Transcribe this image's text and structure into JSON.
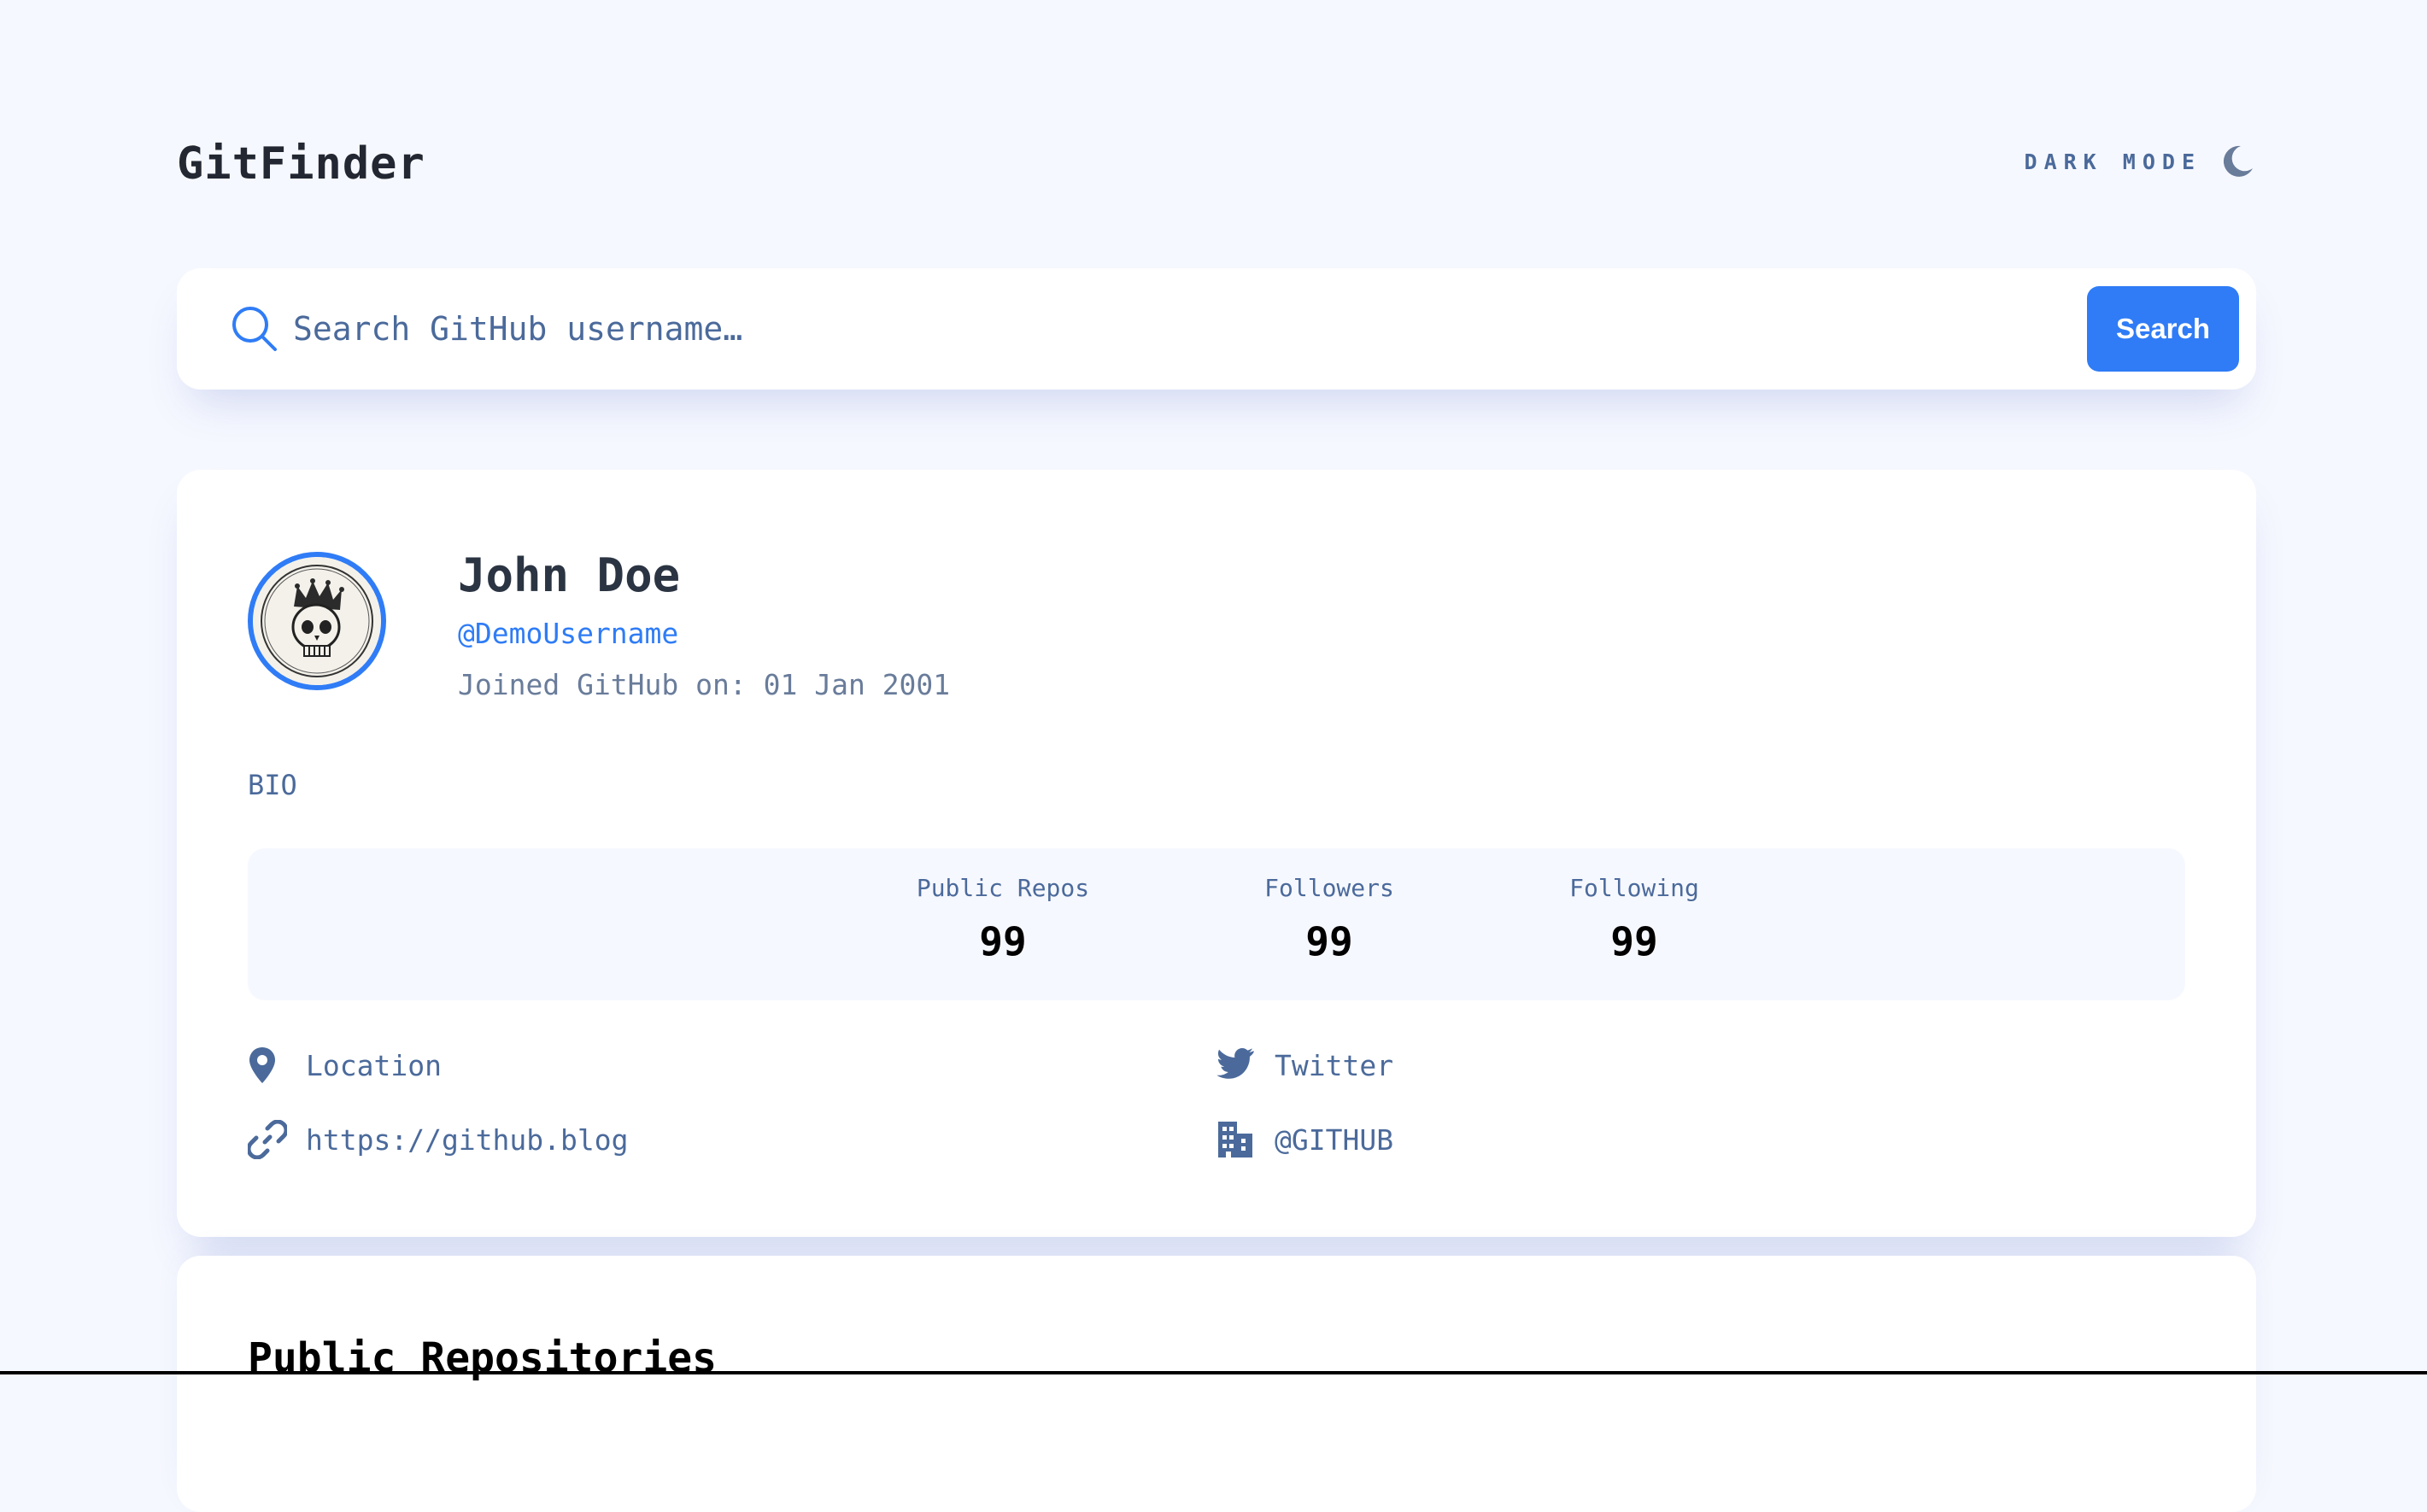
{
  "app": {
    "title": "GitFinder",
    "mode_label": "DARK MODE",
    "mode_icon": "moon-icon"
  },
  "colors": {
    "background": "#f6f8ff",
    "card": "#ffffff",
    "accent": "#2f7cf6",
    "text_muted": "#4b6a9b",
    "text_dark": "#2b3442"
  },
  "search": {
    "placeholder": "Search GitHub username…",
    "value": "",
    "button_label": "Search",
    "icon": "search-icon"
  },
  "profile": {
    "avatar_icon": "skull-crown-avatar",
    "name": "John Doe",
    "login": "@DemoUsername",
    "joined": "Joined GitHub on: 01 Jan 2001",
    "bio": "BIO",
    "stats": [
      {
        "label": "Public Repos",
        "value": "99"
      },
      {
        "label": "Followers",
        "value": "99"
      },
      {
        "label": "Following",
        "value": "99"
      }
    ],
    "links": {
      "location": {
        "text": "Location",
        "icon": "location-pin-icon"
      },
      "twitter": {
        "text": "Twitter",
        "icon": "twitter-icon"
      },
      "blog": {
        "text": "https://github.blog",
        "icon": "link-icon"
      },
      "company": {
        "text": "@GITHUB",
        "icon": "building-icon"
      }
    }
  },
  "repos": {
    "title": "Public Repositories"
  }
}
